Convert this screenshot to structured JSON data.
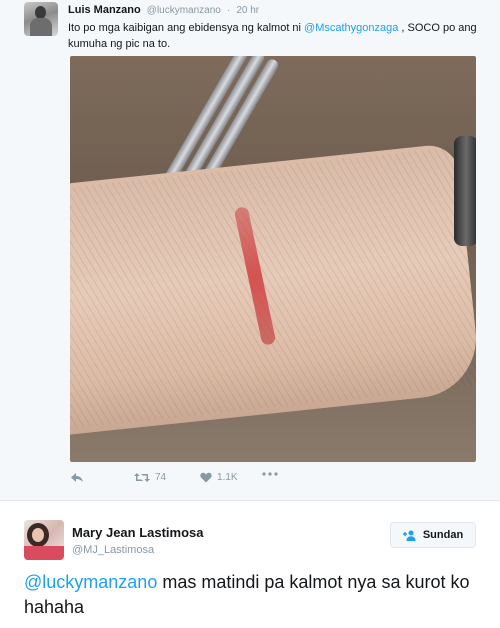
{
  "tweet1": {
    "author_name": "Luis Manzano",
    "author_handle": "@luckymanzano",
    "separator": "·",
    "time": "20 hr",
    "text_before": "Ito po mga kaibigan ang ebidensya ng kalmot ni ",
    "mention": "@Mscathygonzaga",
    "text_after": " , SOCO po ang kumuha ng pic na to.",
    "retweets": "74",
    "likes": "1.1K",
    "icons": {
      "reply": "reply-icon",
      "retweet": "retweet-icon",
      "like": "heart-icon",
      "more": "more-icon"
    }
  },
  "tweet2": {
    "author_name": "Mary Jean Lastimosa",
    "author_handle": "@MJ_Lastimosa",
    "follow_label": "Sundan",
    "mention": "@luckymanzano",
    "text_after": " mas matindi pa kalmot nya sa kurot ko hahaha"
  },
  "colors": {
    "link": "#1da1f2",
    "secondary_text": "#8899a6",
    "follow_icon": "#1da1f2",
    "card_bg": "#f5f8fa"
  }
}
